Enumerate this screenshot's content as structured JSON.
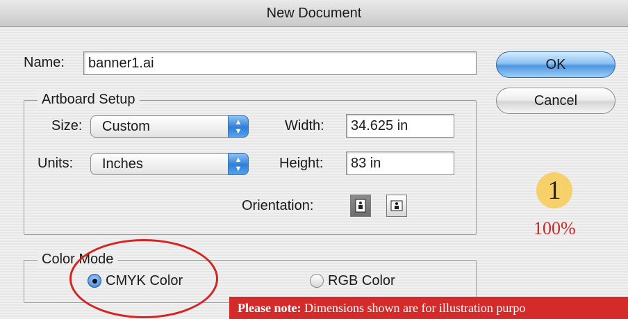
{
  "window": {
    "title": "New Document"
  },
  "name_field": {
    "label": "Name:",
    "value": "banner1.ai"
  },
  "buttons": {
    "ok": "OK",
    "cancel": "Cancel"
  },
  "artboard": {
    "legend": "Artboard Setup",
    "size": {
      "label": "Size:",
      "value": "Custom"
    },
    "units": {
      "label": "Units:",
      "value": "Inches"
    },
    "width": {
      "label": "Width:",
      "value": "34.625 in"
    },
    "height": {
      "label": "Height:",
      "value": "83 in"
    },
    "orientation": {
      "label": "Orientation:",
      "selected": "portrait"
    }
  },
  "color_mode": {
    "legend": "Color Mode",
    "options": [
      {
        "label": "CMYK Color",
        "selected": true
      },
      {
        "label": "RGB Color",
        "selected": false
      }
    ]
  },
  "annotation": {
    "step_number": "1",
    "zoom": "100%",
    "note_bold": "Please note:",
    "note_text": " Dimensions shown are for illustration purpo"
  },
  "colors": {
    "accent_blue": "#4f96e0",
    "annotation_red": "#d42a2a",
    "badge_yellow": "#f6d06a"
  }
}
